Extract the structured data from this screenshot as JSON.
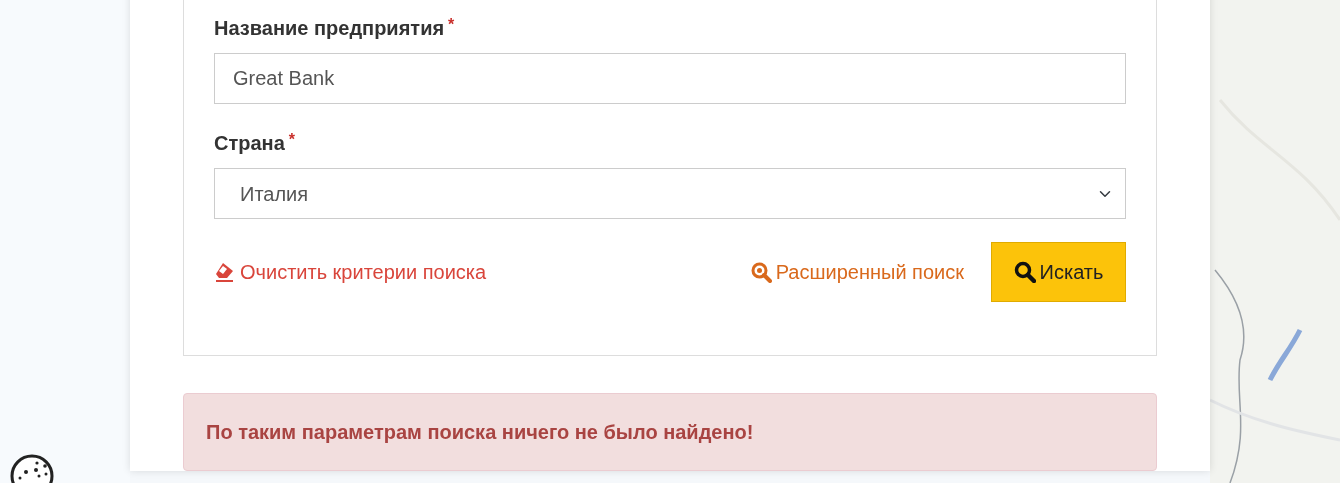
{
  "fields": [
    {
      "kind": "text",
      "label": "Название предприятия",
      "required_mark": "*",
      "value": "Great Bank"
    },
    {
      "kind": "select",
      "label": "Страна",
      "required_mark": "*",
      "value": "Италия"
    }
  ],
  "clear_link": "Очистить критерии поиска",
  "advanced_link": "Расширенный поиск",
  "search_button": "Искать",
  "alert": "По таким параметрам поиска ничего не было найдено!"
}
